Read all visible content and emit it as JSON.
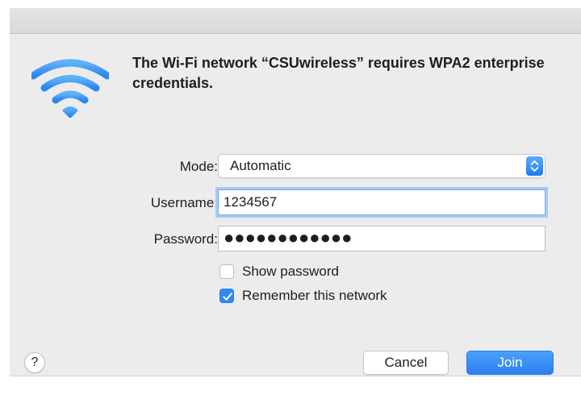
{
  "dialog": {
    "headline": "The Wi-Fi network “CSUwireless” requires WPA2 enterprise credentials.",
    "icon": "wifi-icon",
    "accent_color": "#2f88f4"
  },
  "form": {
    "mode_label": "Mode:",
    "mode_value": "Automatic",
    "username_label": "Username:",
    "username_value": "1234567",
    "password_label": "Password:",
    "password_masked": "●●●●●●●●●●●●"
  },
  "options": {
    "show_password_label": "Show password",
    "show_password_checked": false,
    "remember_label": "Remember this network",
    "remember_checked": true
  },
  "buttons": {
    "help_label": "?",
    "cancel_label": "Cancel",
    "join_label": "Join"
  }
}
